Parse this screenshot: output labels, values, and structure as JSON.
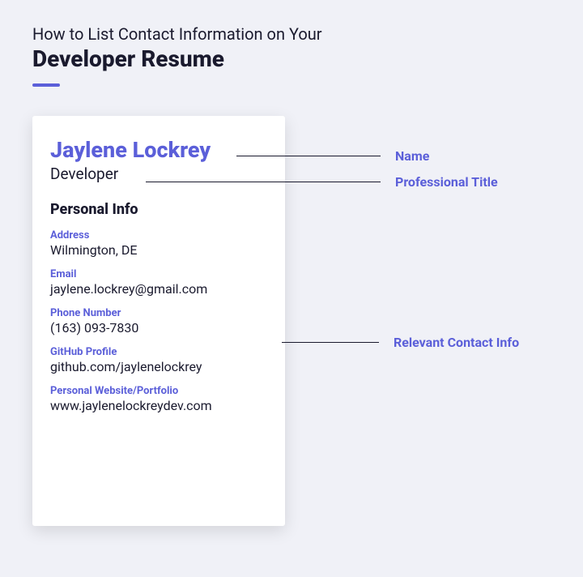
{
  "header": {
    "subtitle": "How to List Contact Information on Your",
    "title": "Developer Resume"
  },
  "card": {
    "name": "Jaylene Lockrey",
    "title": "Developer",
    "section_heading": "Personal Info",
    "info": [
      {
        "label": "Address",
        "value": "Wilmington, DE"
      },
      {
        "label": "Email",
        "value": "jaylene.lockrey@gmail.com"
      },
      {
        "label": "Phone Number",
        "value": "(163) 093-7830"
      },
      {
        "label": "GitHub Profile",
        "value": "github.com/jaylenelockrey"
      },
      {
        "label": "Personal Website/Portfolio",
        "value": "www.jaylenelockreydev.com"
      }
    ]
  },
  "callouts": {
    "name": "Name",
    "title": "Professional Title",
    "contact": "Relevant Contact Info"
  }
}
